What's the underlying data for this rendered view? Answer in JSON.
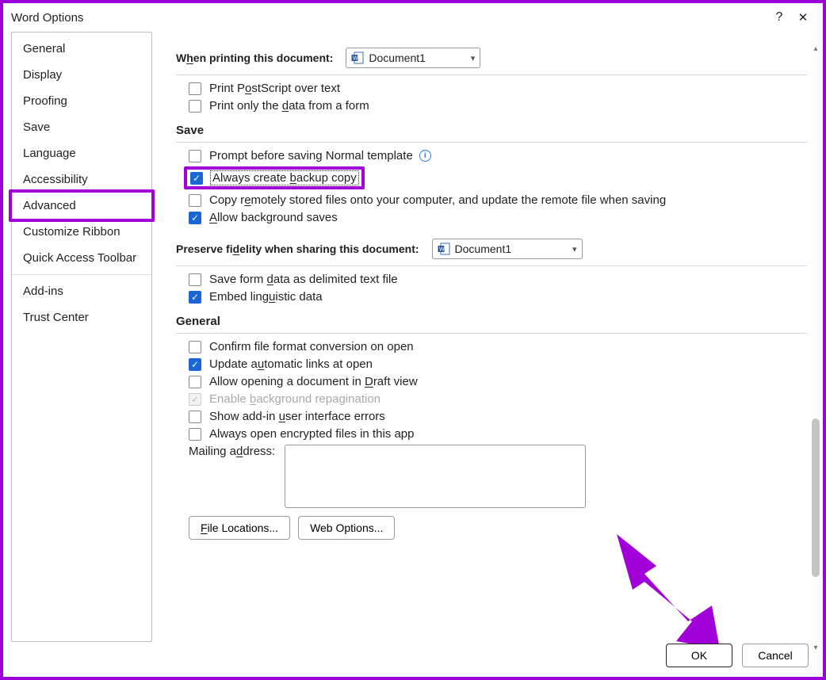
{
  "title": "Word Options",
  "help_symbol": "?",
  "close_symbol": "✕",
  "sidebar": {
    "items": [
      "General",
      "Display",
      "Proofing",
      "Save",
      "Language",
      "Accessibility",
      "Advanced",
      "Customize Ribbon",
      "Quick Access Toolbar",
      "Add-ins",
      "Trust Center"
    ],
    "selected": "Advanced"
  },
  "printing": {
    "heading_pre": "W",
    "heading_u": "h",
    "heading_post": "en printing this document:",
    "doc_selected": "Document1",
    "postscript_pre": "Print P",
    "postscript_u": "o",
    "postscript_post": "stScript over text",
    "dataform_pre": "Print only the ",
    "dataform_u": "d",
    "dataform_post": "ata from a form"
  },
  "save": {
    "heading": "Save",
    "prompt_normal": "Prompt before saving Normal template",
    "backup_pre": "Always create ",
    "backup_u": "b",
    "backup_post": "ackup copy",
    "copy_remote_pre": "Copy r",
    "copy_remote_u": "e",
    "copy_remote_post": "motely stored files onto your computer, and update the remote file when saving",
    "bg_saves_pre": "",
    "bg_saves_u": "A",
    "bg_saves_post": "llow background saves"
  },
  "fidelity": {
    "heading_pre": "Preserve fi",
    "heading_u": "d",
    "heading_post": "elity when sharing this document:",
    "doc_selected": "Document1",
    "delimited_pre": "Save form ",
    "delimited_u": "d",
    "delimited_post": "ata as delimited text file",
    "linguistic_pre": "Embed ling",
    "linguistic_u": "u",
    "linguistic_post": "istic data"
  },
  "general": {
    "heading": "General",
    "confirm_conv": "Confirm file format conversion on open",
    "update_links_pre": "Update a",
    "update_links_u": "u",
    "update_links_post": "tomatic links at open",
    "draft_pre": "Allow opening a document in ",
    "draft_u": "D",
    "draft_post": "raft view",
    "bg_repag_pre": "Enable ",
    "bg_repag_u": "b",
    "bg_repag_post": "ackground repagination",
    "addin_err_pre": "Show add-in ",
    "addin_err_u": "u",
    "addin_err_post": "ser interface errors",
    "encrypted": "Always open encrypted files in this app",
    "mailing_pre": "Mailing a",
    "mailing_u": "d",
    "mailing_post": "dress:",
    "file_locations_u": "F",
    "file_locations_post": "ile Locations...",
    "web_options": "Web Options..."
  },
  "footer": {
    "ok": "OK",
    "cancel": "Cancel"
  }
}
